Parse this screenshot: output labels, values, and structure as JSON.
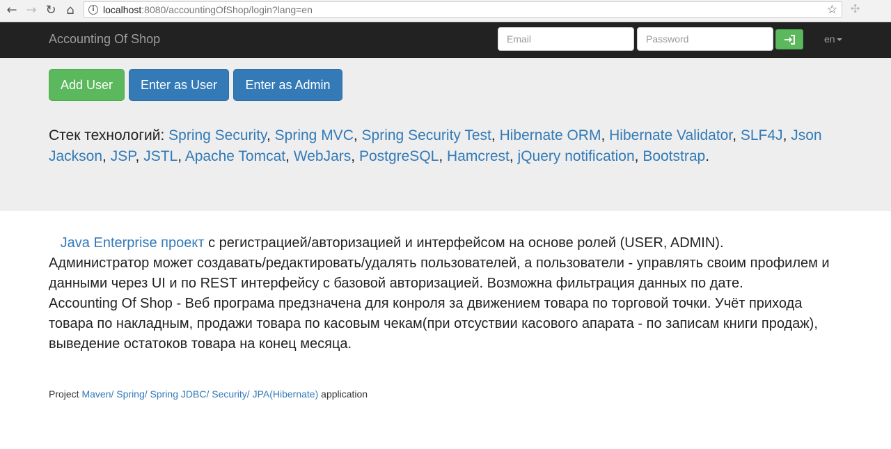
{
  "browser": {
    "url_host": "localhost",
    "url_rest": ":8080/accountingOfShop/login?lang=en"
  },
  "navbar": {
    "brand": "Accounting Of Shop",
    "email_placeholder": "Email",
    "password_placeholder": "Password",
    "lang": "en"
  },
  "buttons": {
    "add_user": "Add User",
    "enter_user": "Enter as User",
    "enter_admin": "Enter as Admin"
  },
  "stack": {
    "label": "Стек технологий:",
    "items": [
      "Spring Security",
      "Spring MVC",
      "Spring Security Test",
      "Hibernate ORM",
      "Hibernate Validator",
      "SLF4J",
      "Json Jackson",
      "JSP",
      "JSTL",
      "Apache Tomcat",
      "WebJars",
      "PostgreSQL",
      "Hamcrest",
      "jQuery notification",
      "Bootstrap"
    ],
    "separator": ", ",
    "end": "."
  },
  "description": {
    "link": "Java Enterprise проект",
    "line1_rest": " с регистрацией/авторизацией и интерфейсом на основе ролей (USER, ADMIN).",
    "para1": "Администратор может создавать/редактировать/удалять пользователей, а пользователи - управлять своим профилем и данными через UI и по REST интерфейсу с базовой авторизацией. Возможна фильтрация данных по дате.",
    "para2": "Accounting Of Shop - Веб програма предзначена для конроля за движением товара по торговой точки. Учёт прихода товара по накладным, продажи товара по касовым чекам(при отсуствии касового апарата - по записам книги продаж), выведение остатоков товара на конец месяца."
  },
  "footer": {
    "prefix": "Project ",
    "links": [
      "Maven/",
      "Spring/",
      "Spring JDBC/",
      "Security/",
      "JPA(Hibernate)"
    ],
    "suffix": " application"
  },
  "colors": {
    "navbar": "#222222",
    "jumbotron": "#eeeeee",
    "success": "#5cb85c",
    "primary": "#337ab7",
    "link": "#337ab7"
  }
}
